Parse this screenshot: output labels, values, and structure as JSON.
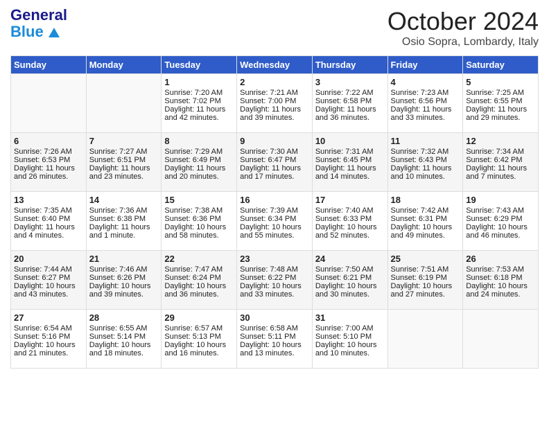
{
  "header": {
    "logo_general": "General",
    "logo_blue": "Blue",
    "title": "October 2024",
    "subtitle": "Osio Sopra, Lombardy, Italy"
  },
  "days_of_week": [
    "Sunday",
    "Monday",
    "Tuesday",
    "Wednesday",
    "Thursday",
    "Friday",
    "Saturday"
  ],
  "weeks": [
    [
      {
        "day": "",
        "content": ""
      },
      {
        "day": "",
        "content": ""
      },
      {
        "day": "1",
        "content": "Sunrise: 7:20 AM\nSunset: 7:02 PM\nDaylight: 11 hours and 42 minutes."
      },
      {
        "day": "2",
        "content": "Sunrise: 7:21 AM\nSunset: 7:00 PM\nDaylight: 11 hours and 39 minutes."
      },
      {
        "day": "3",
        "content": "Sunrise: 7:22 AM\nSunset: 6:58 PM\nDaylight: 11 hours and 36 minutes."
      },
      {
        "day": "4",
        "content": "Sunrise: 7:23 AM\nSunset: 6:56 PM\nDaylight: 11 hours and 33 minutes."
      },
      {
        "day": "5",
        "content": "Sunrise: 7:25 AM\nSunset: 6:55 PM\nDaylight: 11 hours and 29 minutes."
      }
    ],
    [
      {
        "day": "6",
        "content": "Sunrise: 7:26 AM\nSunset: 6:53 PM\nDaylight: 11 hours and 26 minutes."
      },
      {
        "day": "7",
        "content": "Sunrise: 7:27 AM\nSunset: 6:51 PM\nDaylight: 11 hours and 23 minutes."
      },
      {
        "day": "8",
        "content": "Sunrise: 7:29 AM\nSunset: 6:49 PM\nDaylight: 11 hours and 20 minutes."
      },
      {
        "day": "9",
        "content": "Sunrise: 7:30 AM\nSunset: 6:47 PM\nDaylight: 11 hours and 17 minutes."
      },
      {
        "day": "10",
        "content": "Sunrise: 7:31 AM\nSunset: 6:45 PM\nDaylight: 11 hours and 14 minutes."
      },
      {
        "day": "11",
        "content": "Sunrise: 7:32 AM\nSunset: 6:43 PM\nDaylight: 11 hours and 10 minutes."
      },
      {
        "day": "12",
        "content": "Sunrise: 7:34 AM\nSunset: 6:42 PM\nDaylight: 11 hours and 7 minutes."
      }
    ],
    [
      {
        "day": "13",
        "content": "Sunrise: 7:35 AM\nSunset: 6:40 PM\nDaylight: 11 hours and 4 minutes."
      },
      {
        "day": "14",
        "content": "Sunrise: 7:36 AM\nSunset: 6:38 PM\nDaylight: 11 hours and 1 minute."
      },
      {
        "day": "15",
        "content": "Sunrise: 7:38 AM\nSunset: 6:36 PM\nDaylight: 10 hours and 58 minutes."
      },
      {
        "day": "16",
        "content": "Sunrise: 7:39 AM\nSunset: 6:34 PM\nDaylight: 10 hours and 55 minutes."
      },
      {
        "day": "17",
        "content": "Sunrise: 7:40 AM\nSunset: 6:33 PM\nDaylight: 10 hours and 52 minutes."
      },
      {
        "day": "18",
        "content": "Sunrise: 7:42 AM\nSunset: 6:31 PM\nDaylight: 10 hours and 49 minutes."
      },
      {
        "day": "19",
        "content": "Sunrise: 7:43 AM\nSunset: 6:29 PM\nDaylight: 10 hours and 46 minutes."
      }
    ],
    [
      {
        "day": "20",
        "content": "Sunrise: 7:44 AM\nSunset: 6:27 PM\nDaylight: 10 hours and 43 minutes."
      },
      {
        "day": "21",
        "content": "Sunrise: 7:46 AM\nSunset: 6:26 PM\nDaylight: 10 hours and 39 minutes."
      },
      {
        "day": "22",
        "content": "Sunrise: 7:47 AM\nSunset: 6:24 PM\nDaylight: 10 hours and 36 minutes."
      },
      {
        "day": "23",
        "content": "Sunrise: 7:48 AM\nSunset: 6:22 PM\nDaylight: 10 hours and 33 minutes."
      },
      {
        "day": "24",
        "content": "Sunrise: 7:50 AM\nSunset: 6:21 PM\nDaylight: 10 hours and 30 minutes."
      },
      {
        "day": "25",
        "content": "Sunrise: 7:51 AM\nSunset: 6:19 PM\nDaylight: 10 hours and 27 minutes."
      },
      {
        "day": "26",
        "content": "Sunrise: 7:53 AM\nSunset: 6:18 PM\nDaylight: 10 hours and 24 minutes."
      }
    ],
    [
      {
        "day": "27",
        "content": "Sunrise: 6:54 AM\nSunset: 5:16 PM\nDaylight: 10 hours and 21 minutes."
      },
      {
        "day": "28",
        "content": "Sunrise: 6:55 AM\nSunset: 5:14 PM\nDaylight: 10 hours and 18 minutes."
      },
      {
        "day": "29",
        "content": "Sunrise: 6:57 AM\nSunset: 5:13 PM\nDaylight: 10 hours and 16 minutes."
      },
      {
        "day": "30",
        "content": "Sunrise: 6:58 AM\nSunset: 5:11 PM\nDaylight: 10 hours and 13 minutes."
      },
      {
        "day": "31",
        "content": "Sunrise: 7:00 AM\nSunset: 5:10 PM\nDaylight: 10 hours and 10 minutes."
      },
      {
        "day": "",
        "content": ""
      },
      {
        "day": "",
        "content": ""
      }
    ]
  ]
}
